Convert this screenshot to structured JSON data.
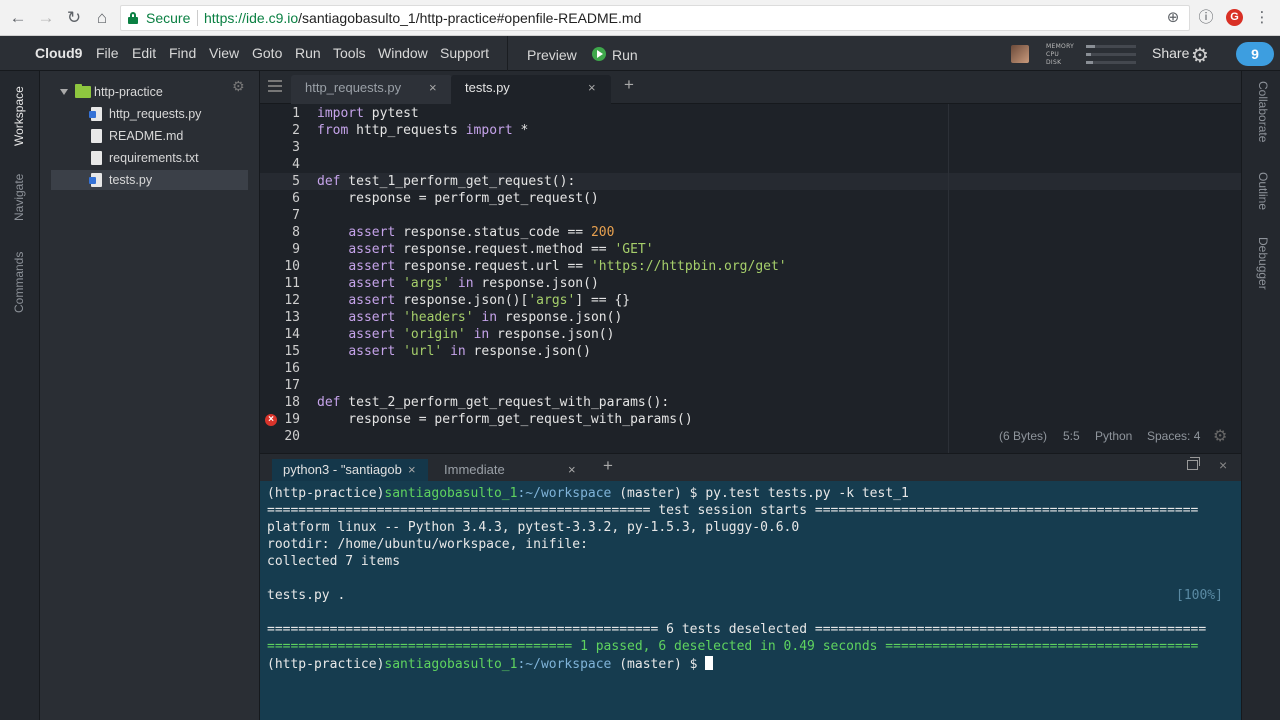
{
  "browser": {
    "back": "←",
    "forward": "→",
    "reload": "↻",
    "home": "⌂",
    "secure_label": "Secure",
    "url_scheme_host": "https://ide.c9.io",
    "url_path": "/santiagobasulto_1/http-practice#openfile-README.md",
    "icon_zoom": "⊕",
    "icon_info": "ⓘ",
    "icon_ext": "G",
    "icon_menu": "⋮"
  },
  "menubar": {
    "logo": "Cloud9",
    "items": [
      "File",
      "Edit",
      "Find",
      "View",
      "Goto",
      "Run",
      "Tools",
      "Window",
      "Support"
    ],
    "preview": "Preview",
    "run": "Run",
    "meters": [
      "MEMORY",
      "CPU",
      "DISK"
    ],
    "meter_levels": [
      0.18,
      0.1,
      0.14
    ],
    "share": "Share",
    "cloud_badge": "9"
  },
  "left_panels": [
    "Workspace",
    "Navigate",
    "Commands"
  ],
  "right_panels": [
    "Collaborate",
    "Outline",
    "Debugger"
  ],
  "filetree": {
    "root": "http-practice",
    "files": [
      {
        "name": "http_requests.py",
        "type": "py"
      },
      {
        "name": "README.md",
        "type": "md"
      },
      {
        "name": "requirements.txt",
        "type": "txt"
      },
      {
        "name": "tests.py",
        "type": "py"
      }
    ]
  },
  "editor_tabs": [
    {
      "label": "http_requests.py",
      "close": "×"
    },
    {
      "label": "tests.py",
      "close": "×"
    }
  ],
  "add_tab": "+",
  "code": {
    "line_numbers": [
      "1",
      "2",
      "3",
      "4",
      "5",
      "6",
      "7",
      "8",
      "9",
      "10",
      "11",
      "12",
      "13",
      "14",
      "15",
      "16",
      "17",
      "18",
      "19",
      "20"
    ],
    "lines": [
      [
        {
          "k": "kw",
          "t": "import"
        },
        {
          "t": " pytest"
        }
      ],
      [
        {
          "k": "kw",
          "t": "from"
        },
        {
          "t": " http_requests "
        },
        {
          "k": "kw",
          "t": "import"
        },
        {
          "t": " *"
        }
      ],
      [],
      [],
      [
        {
          "k": "kw",
          "t": "def"
        },
        {
          "t": " test_1_perform_get_request():"
        }
      ],
      [
        {
          "t": "    response = perform_get_request()"
        }
      ],
      [],
      [
        {
          "t": "    "
        },
        {
          "k": "kw",
          "t": "assert"
        },
        {
          "t": " response.status_code == "
        },
        {
          "k": "num",
          "t": "200"
        }
      ],
      [
        {
          "t": "    "
        },
        {
          "k": "kw",
          "t": "assert"
        },
        {
          "t": " response.request.method == "
        },
        {
          "k": "str",
          "t": "'GET'"
        }
      ],
      [
        {
          "t": "    "
        },
        {
          "k": "kw",
          "t": "assert"
        },
        {
          "t": " response.request.url == "
        },
        {
          "k": "str",
          "t": "'https://httpbin.org/get'"
        }
      ],
      [
        {
          "t": "    "
        },
        {
          "k": "kw",
          "t": "assert"
        },
        {
          "t": " "
        },
        {
          "k": "str",
          "t": "'args'"
        },
        {
          "t": " "
        },
        {
          "k": "kw",
          "t": "in"
        },
        {
          "t": " response.json()"
        }
      ],
      [
        {
          "t": "    "
        },
        {
          "k": "kw",
          "t": "assert"
        },
        {
          "t": " response.json()["
        },
        {
          "k": "str",
          "t": "'args'"
        },
        {
          "t": "] == {}"
        }
      ],
      [
        {
          "t": "    "
        },
        {
          "k": "kw",
          "t": "assert"
        },
        {
          "t": " "
        },
        {
          "k": "str",
          "t": "'headers'"
        },
        {
          "t": " "
        },
        {
          "k": "kw",
          "t": "in"
        },
        {
          "t": " response.json()"
        }
      ],
      [
        {
          "t": "    "
        },
        {
          "k": "kw",
          "t": "assert"
        },
        {
          "t": " "
        },
        {
          "k": "str",
          "t": "'origin'"
        },
        {
          "t": " "
        },
        {
          "k": "kw",
          "t": "in"
        },
        {
          "t": " response.json()"
        }
      ],
      [
        {
          "t": "    "
        },
        {
          "k": "kw",
          "t": "assert"
        },
        {
          "t": " "
        },
        {
          "k": "str",
          "t": "'url'"
        },
        {
          "t": " "
        },
        {
          "k": "kw",
          "t": "in"
        },
        {
          "t": " response.json()"
        }
      ],
      [],
      [],
      [
        {
          "k": "kw",
          "t": "def"
        },
        {
          "t": " test_2_perform_get_request_with_params():"
        }
      ],
      [
        {
          "t": "    response = perform_get_request_with_params()"
        }
      ],
      []
    ]
  },
  "editor_status": {
    "size": "(6 Bytes)",
    "position": "5:5",
    "language": "Python",
    "spaces": "Spaces: 4"
  },
  "terminal_tabs": [
    {
      "label": "python3 - \"santiagob",
      "close": "×"
    },
    {
      "label": "Immediate",
      "close": "×"
    }
  ],
  "terminal": {
    "prompt_env": "(http-practice)",
    "prompt_user": "santiagobasulto_1",
    "prompt_path": ":~/workspace",
    "prompt_branch": " (master) $ ",
    "command": "py.test tests.py -k test_1",
    "session_line": "================================================= test session starts =================================================",
    "platform_line": "platform linux -- Python 3.4.3, pytest-3.3.2, py-1.5.3, pluggy-0.6.0",
    "rootdir_line": "rootdir: /home/ubuntu/workspace, inifile:",
    "collected_line": "collected 7 items",
    "result_line": "tests.py .",
    "percent": "[100%]",
    "deselected_line": "================================================== 6 tests deselected ==================================================",
    "summary_line": "======================================= 1 passed, 6 deselected in 0.49 seconds ========================================"
  }
}
